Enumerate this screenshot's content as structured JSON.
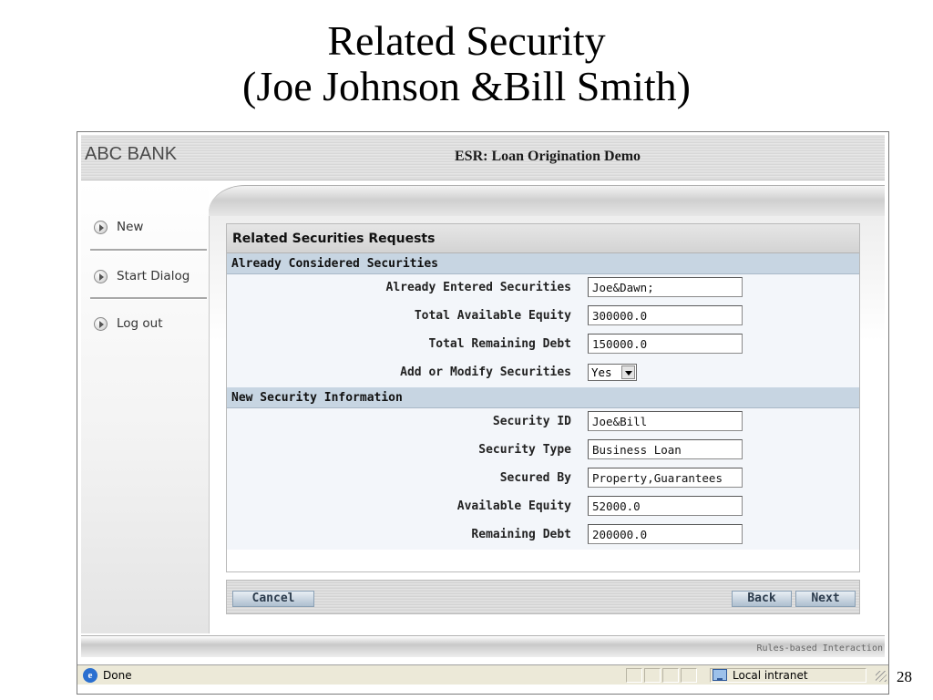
{
  "slide": {
    "title_line1": "Related Security",
    "title_line2": "(Joe Johnson &Bill Smith)",
    "page_number": "28"
  },
  "app": {
    "bank_name": "ABC BANK",
    "title": "ESR: Loan Origination Demo",
    "footer_text": "Rules-based Interaction"
  },
  "sidebar": {
    "items": [
      {
        "label": "New",
        "icon": "play-circle-icon"
      },
      {
        "label": "Start Dialog",
        "icon": "play-circle-icon"
      },
      {
        "label": "Log out",
        "icon": "play-circle-icon"
      }
    ]
  },
  "form": {
    "title": "Related Securities Requests",
    "sections": [
      {
        "header": "Already Considered Securities",
        "fields": [
          {
            "label": "Already Entered Securities",
            "value": "Joe&Dawn;"
          },
          {
            "label": "Total Available Equity",
            "value": "300000.0"
          },
          {
            "label": "Total Remaining Debt",
            "value": "150000.0"
          },
          {
            "label": "Add or Modify Securities",
            "value": "Yes",
            "type": "select"
          }
        ]
      },
      {
        "header": "New Security Information",
        "fields": [
          {
            "label": "Security ID",
            "value": "Joe&Bill"
          },
          {
            "label": "Security Type",
            "value": "Business Loan"
          },
          {
            "label": "Secured By",
            "value": "Property,Guarantees"
          },
          {
            "label": "Available Equity",
            "value": "52000.0"
          },
          {
            "label": "Remaining Debt",
            "value": "200000.0"
          }
        ]
      }
    ]
  },
  "buttons": {
    "cancel": "Cancel",
    "back": "Back",
    "next": "Next"
  },
  "browser_status": {
    "status": "Done",
    "zone": "Local intranet"
  }
}
